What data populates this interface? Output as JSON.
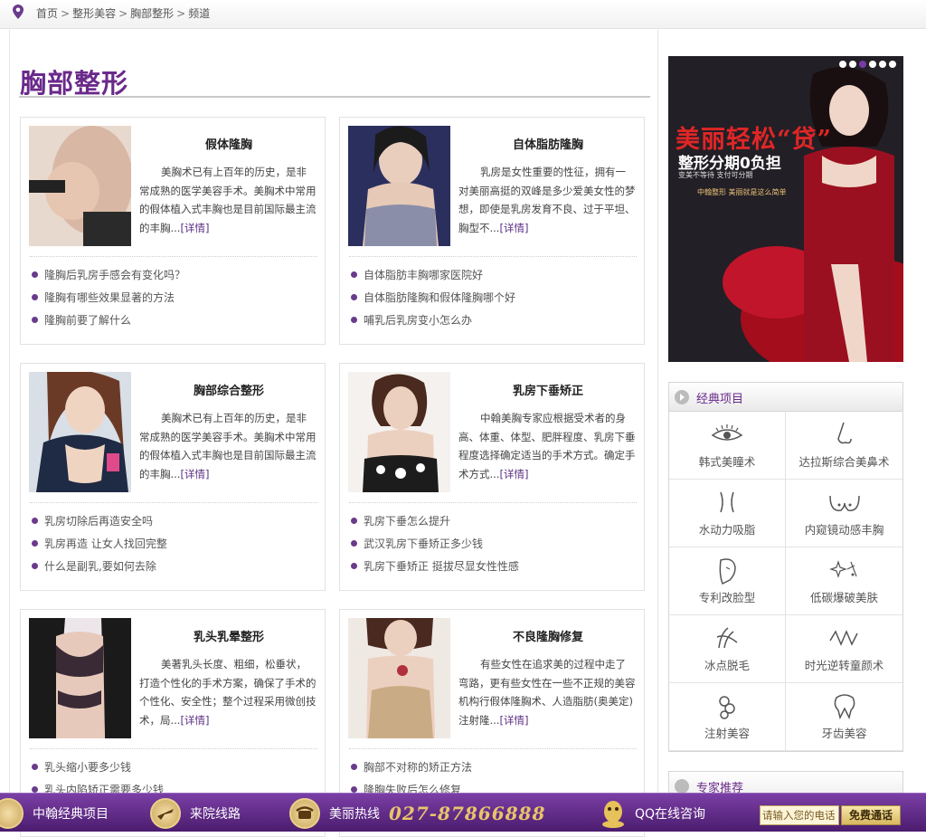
{
  "breadcrumb": {
    "items": [
      "首页",
      "整形美容",
      "胸部整形",
      "频道"
    ],
    "separator": ">"
  },
  "page_title": "胸部整形",
  "cards": [
    {
      "title": "假体隆胸",
      "desc": "美胸术已有上百年的历史，是非常成熟的医学美容手术。美胸术中常用的假体植入式丰胸也是目前国际最主流的丰胸...",
      "more": "[详情]",
      "links": [
        "隆胸后乳房手感会有变化吗？",
        "隆胸有哪些效果显著的方法",
        "隆胸前要了解什么"
      ]
    },
    {
      "title": "自体脂肪隆胸",
      "desc": "乳房是女性重要的性征，拥有一对美丽高挺的双峰是多少爱美女性的梦想，即使是乳房发育不良、过于平坦、胸型不...",
      "more": "[详情]",
      "links": [
        "自体脂肪丰胸哪家医院好",
        "自体脂肪隆胸和假体隆胸哪个好",
        "哺乳后乳房变小怎么办"
      ]
    },
    {
      "title": "胸部综合整形",
      "desc": "美胸术已有上百年的历史，是非常成熟的医学美容手术。美胸术中常用的假体植入式丰胸也是目前国际最主流的丰胸...",
      "more": "[详情]",
      "links": [
        "乳房切除后再造安全吗",
        "乳房再造 让女人找回完整",
        "什么是副乳,要如何去除"
      ]
    },
    {
      "title": "乳房下垂矫正",
      "desc": "中翰美胸专家应根据受术者的身高、体重、体型、肥胖程度、乳房下垂程度选择确定适当的手术方式。确定手术方式...",
      "more": "[详情]",
      "links": [
        "乳房下垂怎么提升",
        "武汉乳房下垂矫正多少钱",
        "乳房下垂矫正 挺拔尽显女性性感"
      ]
    },
    {
      "title": "乳头乳晕整形",
      "desc": "美著乳头长度、粗细，松垂状，打造个性化的手术方案，确保了手术的个性化、安全性；整个过程采用微创技术，局...",
      "more": "[详情]",
      "links": [
        "乳头缩小要多少钱",
        "乳头内陷矫正需要多少钱"
      ]
    },
    {
      "title": "不良隆胸修复",
      "desc": "有些女性在追求美的过程中走了弯路，更有些女性在一些不正规的美容机构行假体隆胸术、人造脂肪(奥美定)注射隆...",
      "more": "[详情]",
      "links": [
        "胸部不对称的矫正方法",
        "隆胸失败后怎么修复"
      ]
    }
  ],
  "banner": {
    "headline": "美丽轻松“贷”",
    "subline": "整形分期0负担",
    "small": "变美不等待  支付可分期",
    "small2": "中翰整形  美丽就是这么简单",
    "dots": 6,
    "active_dot": 3
  },
  "classic_panel": {
    "title": "经典项目",
    "items": [
      {
        "label": "韩式美瞳术",
        "icon": "eye-icon"
      },
      {
        "label": "达拉斯综合美鼻术",
        "icon": "nose-icon"
      },
      {
        "label": "水动力吸脂",
        "icon": "waist-icon"
      },
      {
        "label": "内窥镜动感丰胸",
        "icon": "breast-icon"
      },
      {
        "label": "专利改脸型",
        "icon": "face-icon"
      },
      {
        "label": "低碳爆破美肤",
        "icon": "sparkle-icon"
      },
      {
        "label": "冰点脱毛",
        "icon": "hair-icon"
      },
      {
        "label": "时光逆转童颜术",
        "icon": "wave-icon"
      },
      {
        "label": "注射美容",
        "icon": "injection-icon"
      },
      {
        "label": "牙齿美容",
        "icon": "tooth-icon"
      }
    ]
  },
  "expert_panel": {
    "title": "专家推荐"
  },
  "bottom_bar": {
    "item1": "中翰经典项目",
    "item2": "来院线路",
    "item3": "美丽热线",
    "phone": "027-87866888",
    "item4": "QQ在线咨询",
    "input_placeholder": "请输入您的电话",
    "button": "免费通话"
  },
  "colors": {
    "accent": "#6a2a8a",
    "bar": "#5a2a80",
    "gold": "#e9c46a"
  }
}
